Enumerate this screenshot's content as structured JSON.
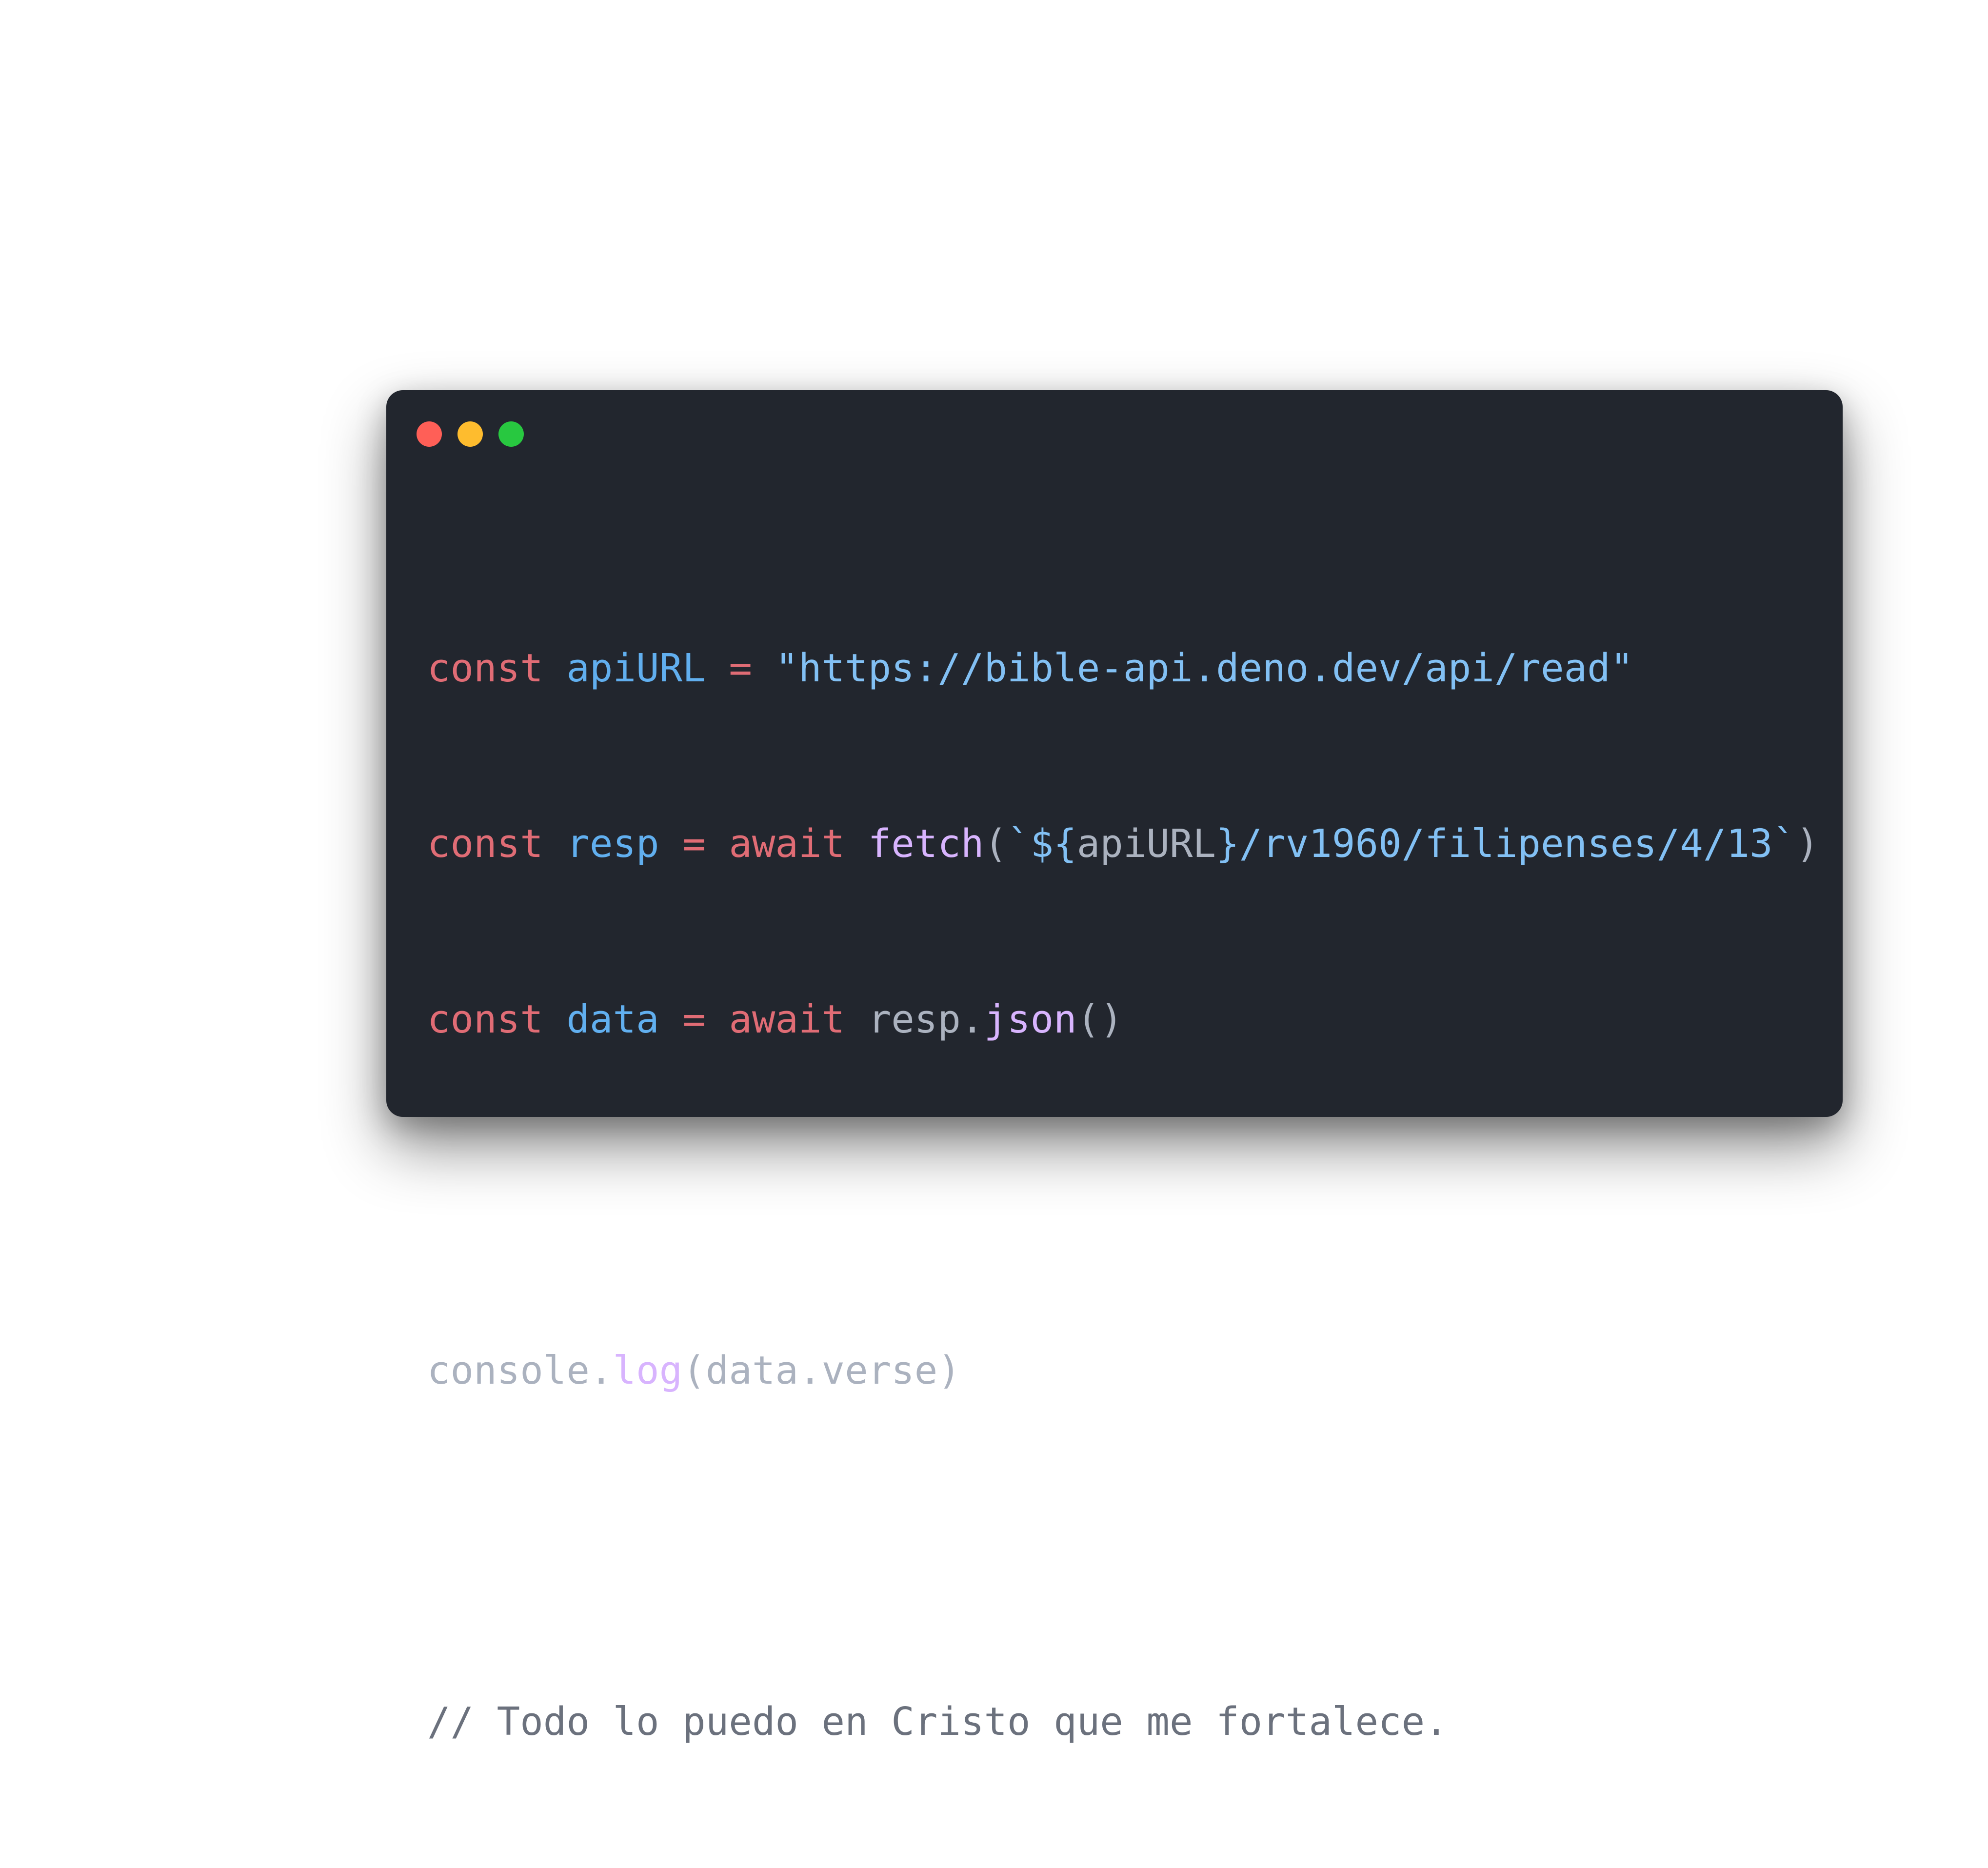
{
  "window": {
    "controls": {
      "close_color": "#ff5f57",
      "minimize_color": "#febc2e",
      "maximize_color": "#28c840"
    }
  },
  "code": {
    "line1": {
      "kw": "const",
      "var": "apiURL",
      "op": "=",
      "str": "\"https://bible-api.deno.dev/api/read\""
    },
    "line2": {
      "kw": "const",
      "var": "resp",
      "op": "=",
      "await": "await",
      "fn": "fetch",
      "paren_open": "(",
      "tpl_start": "`${",
      "tpl_var": "apiURL",
      "tpl_rest": "}/rv1960/filipenses/4/13`",
      "paren_close": ")"
    },
    "line3": {
      "kw": "const",
      "var": "data",
      "op": "=",
      "await": "await",
      "obj": "resp.",
      "fn": "json",
      "parens": "()"
    },
    "line4": {
      "obj": "console.",
      "fn": "log",
      "args": "(data.verse)"
    },
    "comment": "// Todo lo puedo en Cristo que me fortalece."
  }
}
